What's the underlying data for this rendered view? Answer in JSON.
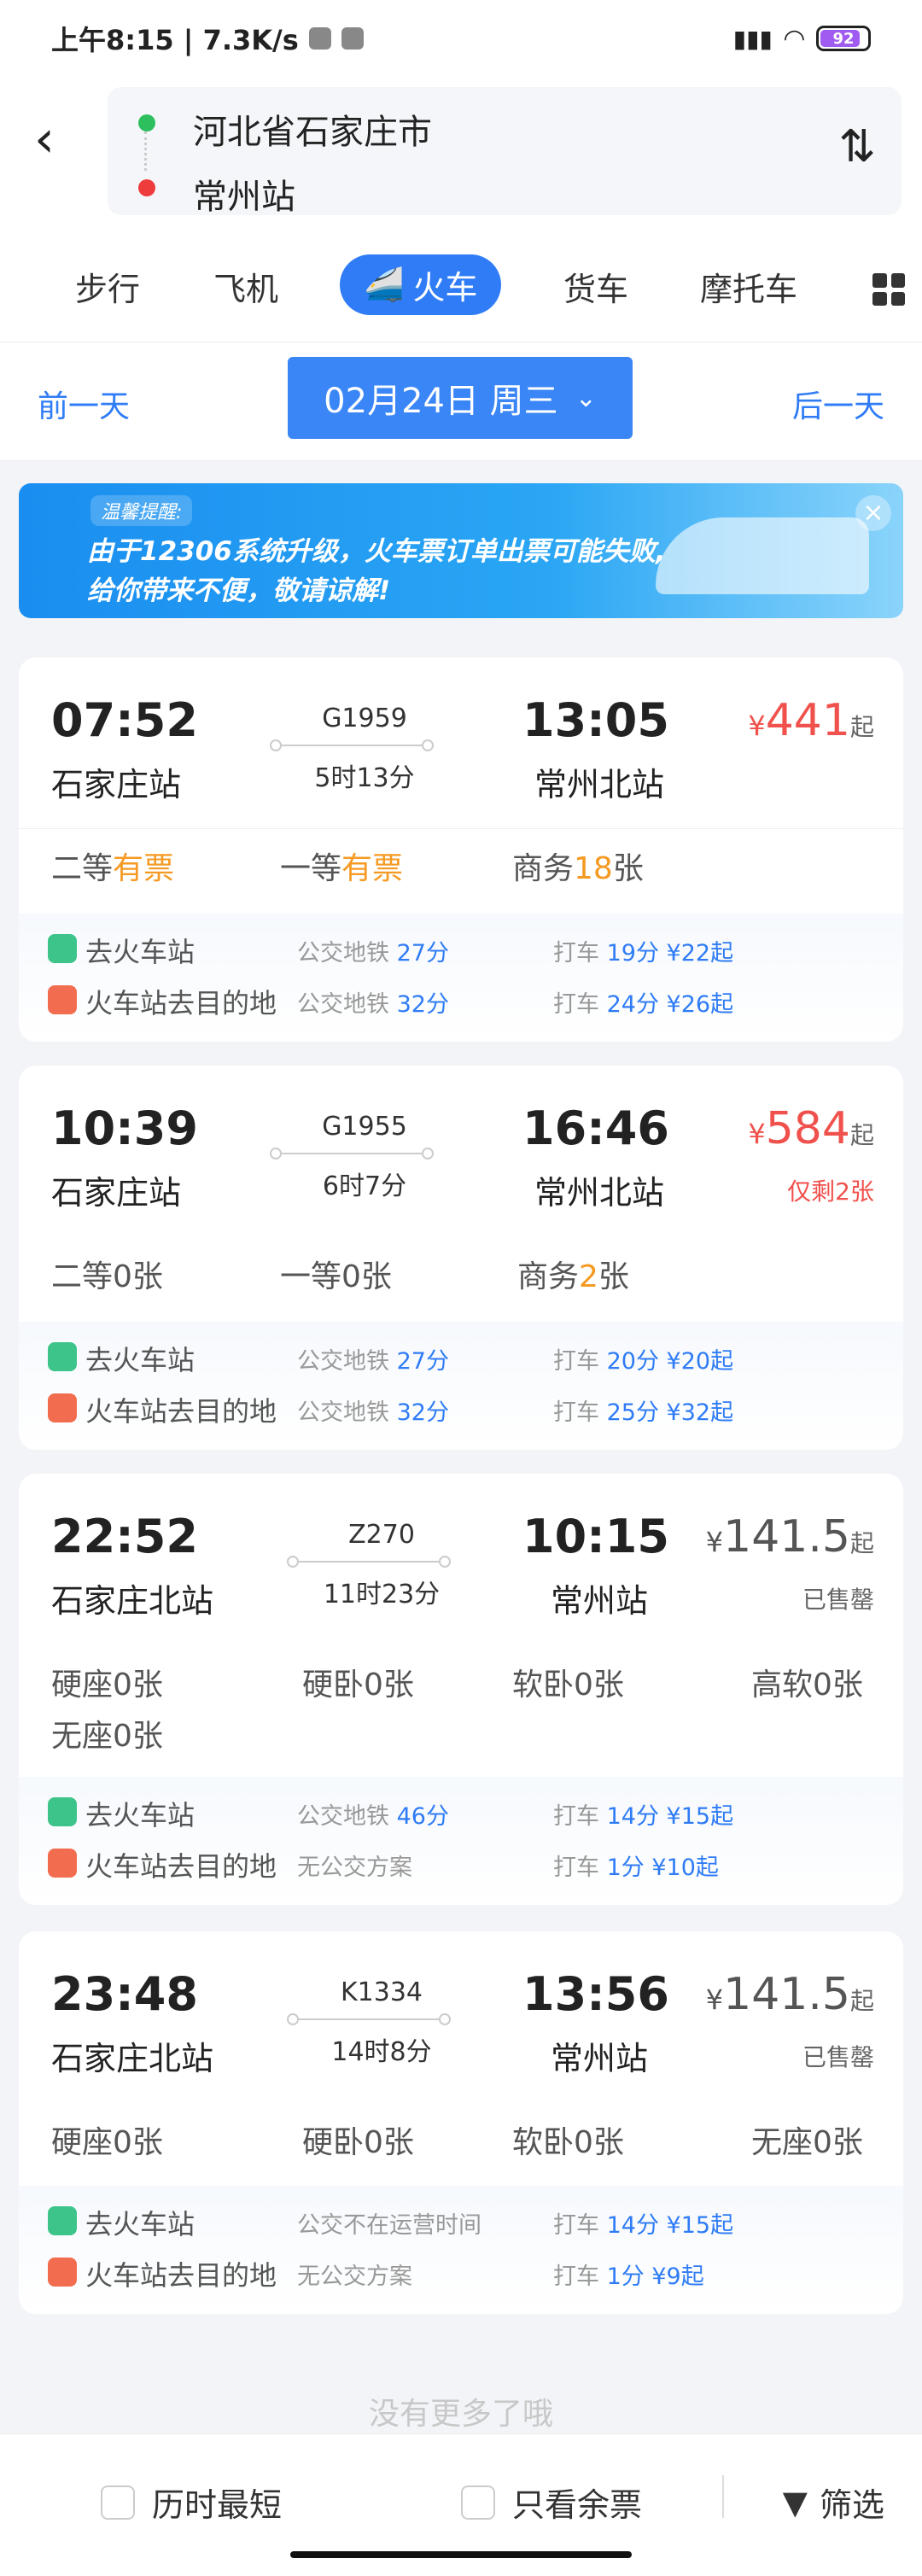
{
  "status_bar": {
    "time": "上午8:15 | 7.3K/s",
    "battery": "92"
  },
  "route": {
    "from": "河北省石家庄市",
    "to": "常州站"
  },
  "tabs": [
    {
      "label": "步行"
    },
    {
      "label": "飞机"
    },
    {
      "label": "火车",
      "active": true
    },
    {
      "label": "货车"
    },
    {
      "label": "摩托车"
    }
  ],
  "date_bar": {
    "prev": "前一天",
    "date": "02月24日 周三",
    "next": "后一天"
  },
  "banner": {
    "tip": "温馨提醒:",
    "line1": "由于12306系统升级，火车票订单出票可能失败,",
    "line2": "给你带来不便，敬请谅解!"
  },
  "trains": [
    {
      "dep_time": "07:52",
      "dep_station": "石家庄站",
      "train_no": "G1959",
      "duration": "5时13分",
      "arr_time": "13:05",
      "arr_station": "常州北站",
      "price_symbol": "¥",
      "price": "441",
      "price_suffix": "起",
      "note": "",
      "seats": [
        {
          "name": "二等",
          "value": "有票"
        },
        {
          "name": "一等",
          "value": "有票"
        },
        {
          "name": "商务",
          "value": "18",
          "unit": "张"
        }
      ],
      "to_station": {
        "label": "去火车站",
        "bus_label": "公交地铁",
        "bus": "27分",
        "taxi_label": "打车",
        "taxi": "19分 ¥22起"
      },
      "to_dest": {
        "label": "火车站去目的地",
        "bus_label": "公交地铁",
        "bus": "32分",
        "taxi_label": "打车",
        "taxi": "24分 ¥26起"
      }
    },
    {
      "dep_time": "10:39",
      "dep_station": "石家庄站",
      "train_no": "G1955",
      "duration": "6时7分",
      "arr_time": "16:46",
      "arr_station": "常州北站",
      "price_symbol": "¥",
      "price": "584",
      "price_suffix": "起",
      "note": "仅剩2张",
      "seats": [
        {
          "name": "二等",
          "value": "0",
          "unit": "张"
        },
        {
          "name": "一等",
          "value": "0",
          "unit": "张"
        },
        {
          "name": "商务",
          "value": "2",
          "unit": "张"
        }
      ],
      "to_station": {
        "label": "去火车站",
        "bus_label": "公交地铁",
        "bus": "27分",
        "taxi_label": "打车",
        "taxi": "20分 ¥20起"
      },
      "to_dest": {
        "label": "火车站去目的地",
        "bus_label": "公交地铁",
        "bus": "32分",
        "taxi_label": "打车",
        "taxi": "25分 ¥32起"
      }
    },
    {
      "dep_time": "22:52",
      "dep_station": "石家庄北站",
      "train_no": "Z270",
      "duration": "11时23分",
      "arr_time": "10:15",
      "arr_station": "常州站",
      "price_symbol": "¥",
      "price": "141.5",
      "price_suffix": "起",
      "note": "已售罄",
      "seats": [
        {
          "name": "硬座",
          "value": "0",
          "unit": "张"
        },
        {
          "name": "硬卧",
          "value": "0",
          "unit": "张"
        },
        {
          "name": "软卧",
          "value": "0",
          "unit": "张"
        },
        {
          "name": "高软",
          "value": "0",
          "unit": "张"
        },
        {
          "name": "无座",
          "value": "0",
          "unit": "张"
        }
      ],
      "to_station": {
        "label": "去火车站",
        "bus_label": "公交地铁",
        "bus": "46分",
        "taxi_label": "打车",
        "taxi": "14分 ¥15起"
      },
      "to_dest": {
        "label": "火车站去目的地",
        "bus_label": "无公交方案",
        "bus": "",
        "taxi_label": "打车",
        "taxi": "1分 ¥10起"
      }
    },
    {
      "dep_time": "23:48",
      "dep_station": "石家庄北站",
      "train_no": "K1334",
      "duration": "14时8分",
      "arr_time": "13:56",
      "arr_station": "常州站",
      "price_symbol": "¥",
      "price": "141.5",
      "price_suffix": "起",
      "note": "已售罄",
      "seats": [
        {
          "name": "硬座",
          "value": "0",
          "unit": "张"
        },
        {
          "name": "硬卧",
          "value": "0",
          "unit": "张"
        },
        {
          "name": "软卧",
          "value": "0",
          "unit": "张"
        },
        {
          "name": "无座",
          "value": "0",
          "unit": "张"
        }
      ],
      "to_station": {
        "label": "去火车站",
        "bus_label": "公交不在运营时间",
        "bus": "",
        "taxi_label": "打车",
        "taxi": "14分 ¥15起"
      },
      "to_dest": {
        "label": "火车站去目的地",
        "bus_label": "无公交方案",
        "bus": "",
        "taxi_label": "打车",
        "taxi": "1分 ¥9起"
      }
    }
  ],
  "footer_text": "没有更多了哦",
  "bottom_bar": {
    "shortest": "历时最短",
    "available": "只看余票",
    "filter": "筛选"
  },
  "colors": {
    "accent": "#2f7cf6",
    "price_red": "#f0514c",
    "orange": "#f59a22",
    "green_dot": "#2dbf5d",
    "red_dot": "#ee3b3b"
  }
}
